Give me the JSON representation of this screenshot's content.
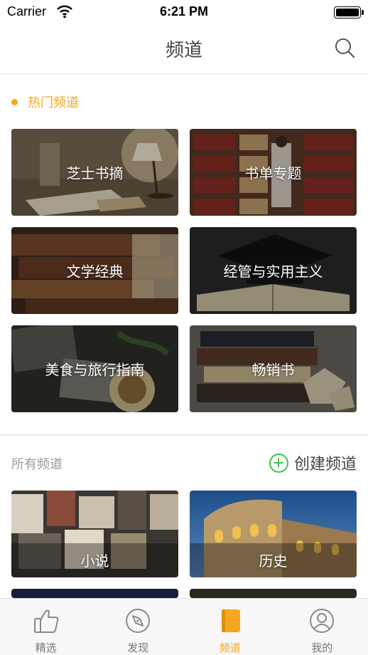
{
  "status_bar": {
    "carrier": "Carrier",
    "time": "6:21 PM",
    "battery_level": 1.0
  },
  "nav": {
    "title": "频道",
    "search_icon": "search-icon"
  },
  "hot": {
    "title": "热门频道",
    "channels": [
      {
        "label": "芝士书摘",
        "scene": "desk-lamp-books"
      },
      {
        "label": "书单专题",
        "scene": "library-shelves"
      },
      {
        "label": "文学经典",
        "scene": "antique-books"
      },
      {
        "label": "经管与实用主义",
        "scene": "graduation-cap-book"
      },
      {
        "label": "美食与旅行指南",
        "scene": "food-travel-collage"
      },
      {
        "label": "畅销书",
        "scene": "books-paper-flowers"
      }
    ]
  },
  "all": {
    "title": "所有频道",
    "create_label": "创建频道",
    "channels": [
      {
        "label": "小说",
        "scene": "magazine-wall"
      },
      {
        "label": "历史",
        "scene": "colosseum"
      }
    ]
  },
  "tabs": [
    {
      "label": "精选",
      "icon": "thumbs-up-icon",
      "active": false
    },
    {
      "label": "发现",
      "icon": "compass-icon",
      "active": false
    },
    {
      "label": "频道",
      "icon": "book-icon",
      "active": true
    },
    {
      "label": "我的",
      "icon": "user-icon",
      "active": false
    }
  ],
  "colors": {
    "accent": "#f5a623",
    "create": "#3cc34c",
    "divider": "#e6e6e6"
  }
}
